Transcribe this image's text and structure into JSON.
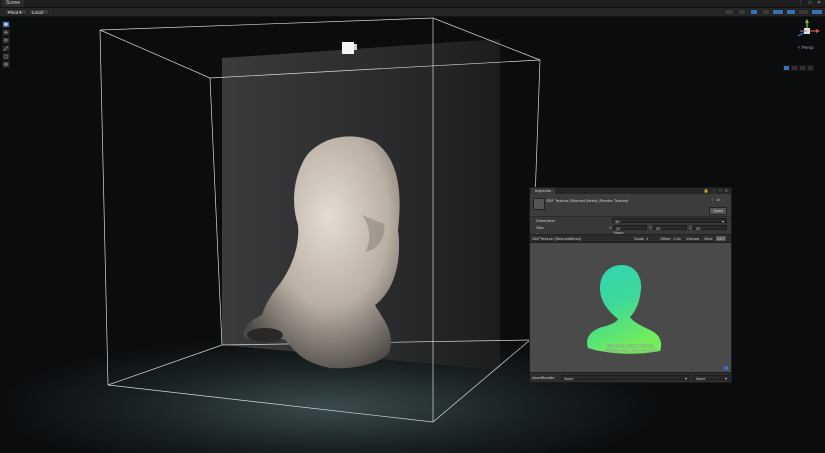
{
  "window": {
    "tab_label": "Scene",
    "controls": "⋮ □ ✕"
  },
  "toolbar": {
    "pivot_label": "Pivot",
    "local_label": "Local"
  },
  "tools": [
    "✥",
    "✛",
    "⟳",
    "⤢",
    "▢",
    "⚙"
  ],
  "gizmo": {
    "mode_label": "< Persp",
    "x": "x",
    "y": "y",
    "z": "z"
  },
  "inspector": {
    "tab_label": "Inspector",
    "tab_controls": "🔒 ⋮ □ ✕",
    "asset_title": "SDF Texture (Skinned Mesh) (Render Texture)",
    "header_controls": "? ⇄ ⋮",
    "open_label": "Open",
    "properties": {
      "dimension_label": "Dimension",
      "dimension_value": "3D",
      "size_label": "Size",
      "size_x_axis": "X",
      "size_x": "32",
      "size_y_axis": "Y",
      "size_y": "32",
      "size_z_axis": "Z",
      "size_z": "32",
      "partial_label": "...",
      "partial_value": "None"
    },
    "preview_bar": {
      "object_name": "SDFTexture (SkinnedMesh)",
      "scale_label": "Scale",
      "scale_value": "1",
      "offset_label": "Offset",
      "offset_value": "1.64",
      "volume_label": "Volume",
      "slice_label": "Slice",
      "mode_label": "DDT"
    },
    "preview_caption_line1": "SDFTexture (SkinnedMesh)",
    "preview_caption_line2": "32x32x32  R16_SFloat  64.0 KB",
    "footer": {
      "assetbundle_label": "AssetBundle",
      "assetbundle_value": "None",
      "variant_value": "None"
    }
  },
  "colors": {
    "accent": "#3a72b0",
    "panel": "#383838",
    "viewport": "#0a0b0d"
  }
}
